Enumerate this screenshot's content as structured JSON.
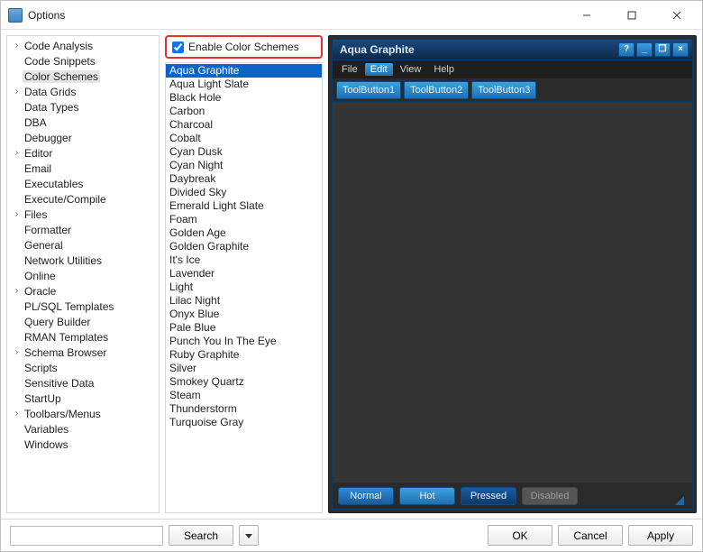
{
  "window": {
    "title": "Options"
  },
  "tree": [
    {
      "label": "Code Analysis",
      "exp": true
    },
    {
      "label": "Code Snippets",
      "exp": false
    },
    {
      "label": "Color Schemes",
      "exp": false,
      "selected": true
    },
    {
      "label": "Data Grids",
      "exp": true
    },
    {
      "label": "Data Types",
      "exp": false
    },
    {
      "label": "DBA",
      "exp": false
    },
    {
      "label": "Debugger",
      "exp": false
    },
    {
      "label": "Editor",
      "exp": true
    },
    {
      "label": "Email",
      "exp": false
    },
    {
      "label": "Executables",
      "exp": false
    },
    {
      "label": "Execute/Compile",
      "exp": false
    },
    {
      "label": "Files",
      "exp": true
    },
    {
      "label": "Formatter",
      "exp": false
    },
    {
      "label": "General",
      "exp": false
    },
    {
      "label": "Network Utilities",
      "exp": false
    },
    {
      "label": "Online",
      "exp": false
    },
    {
      "label": "Oracle",
      "exp": true
    },
    {
      "label": "PL/SQL Templates",
      "exp": false
    },
    {
      "label": "Query Builder",
      "exp": false
    },
    {
      "label": "RMAN Templates",
      "exp": false
    },
    {
      "label": "Schema Browser",
      "exp": true
    },
    {
      "label": "Scripts",
      "exp": false
    },
    {
      "label": "Sensitive Data",
      "exp": false
    },
    {
      "label": "StartUp",
      "exp": false
    },
    {
      "label": "Toolbars/Menus",
      "exp": true
    },
    {
      "label": "Variables",
      "exp": false
    },
    {
      "label": "Windows",
      "exp": false
    }
  ],
  "enable": {
    "label": "Enable Color Schemes",
    "checked": true
  },
  "schemes": [
    "Aqua Graphite",
    "Aqua Light Slate",
    "Black Hole",
    "Carbon",
    "Charcoal",
    "Cobalt",
    "Cyan Dusk",
    "Cyan Night",
    "Daybreak",
    "Divided Sky",
    "Emerald Light Slate",
    "Foam",
    "Golden Age",
    "Golden Graphite",
    "It's Ice",
    "Lavender",
    "Light",
    "Lilac Night",
    "Onyx Blue",
    "Pale Blue",
    "Punch You In The Eye",
    "Ruby Graphite",
    "Silver",
    "Smokey Quartz",
    "Steam",
    "Thunderstorm",
    "Turquoise Gray"
  ],
  "scheme_selected": 0,
  "preview": {
    "title": "Aqua Graphite",
    "winbuttons": [
      "?",
      "_",
      "❐",
      "×"
    ],
    "menus": [
      "File",
      "Edit",
      "View",
      "Help"
    ],
    "menu_active": 1,
    "toolbuttons": [
      "ToolButton1",
      "ToolButton2",
      "ToolButton3"
    ],
    "states": [
      {
        "label": "Normal",
        "cls": "normal"
      },
      {
        "label": "Hot",
        "cls": "hot"
      },
      {
        "label": "Pressed",
        "cls": "pressed"
      },
      {
        "label": "Disabled",
        "cls": "disabled"
      }
    ]
  },
  "footer": {
    "search_btn": "Search",
    "ok": "OK",
    "cancel": "Cancel",
    "apply": "Apply"
  }
}
